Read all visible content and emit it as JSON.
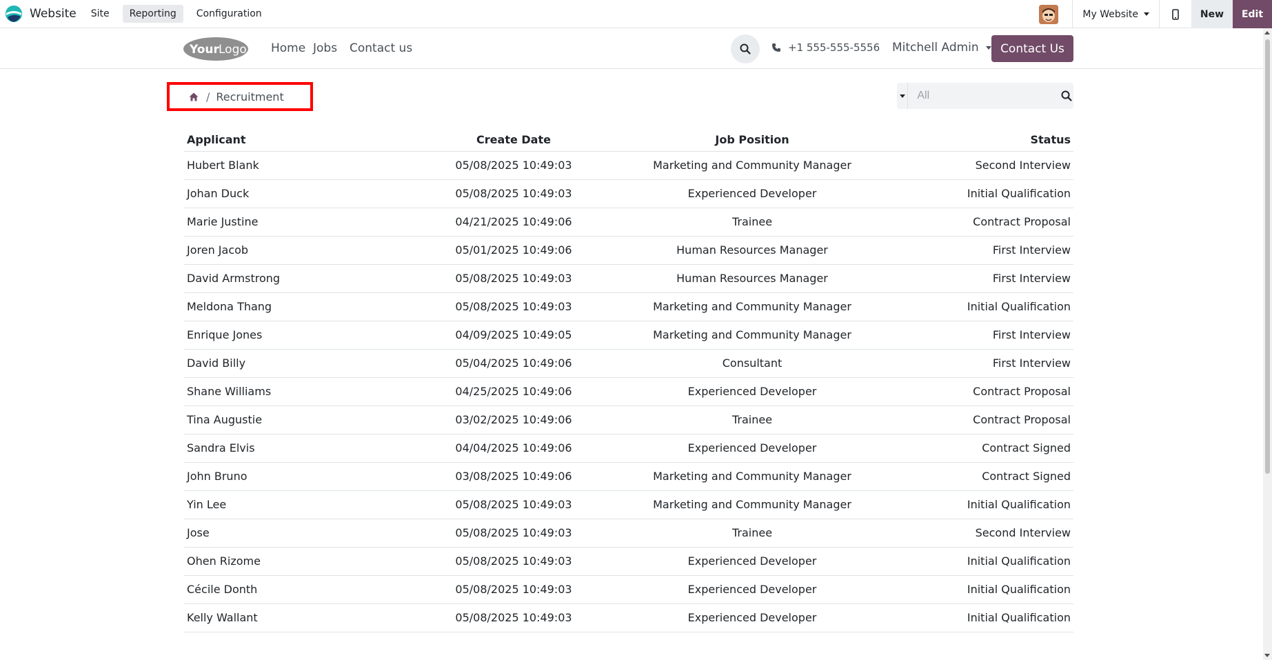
{
  "topbar": {
    "app_name": "Website",
    "menus": [
      "Site",
      "Reporting",
      "Configuration"
    ],
    "active_menu": "Reporting",
    "website_selector": "My Website",
    "new_label": "New",
    "edit_label": "Edit",
    "accent_color": "#714b67"
  },
  "header": {
    "logo_text": "YourLogo",
    "nav": [
      "Home",
      "Jobs",
      "Contact us"
    ],
    "phone": "+1 555-555-5556",
    "user": "Mitchell Admin",
    "contact_button": "Contact Us"
  },
  "breadcrumb": {
    "home_icon": "home-icon",
    "current": "Recruitment"
  },
  "search": {
    "placeholder": "All",
    "value": ""
  },
  "table": {
    "columns": [
      "Applicant",
      "Create Date",
      "Job Position",
      "Status"
    ],
    "rows": [
      [
        "Hubert Blank",
        "05/08/2025 10:49:03",
        "Marketing and Community Manager",
        "Second Interview"
      ],
      [
        "Johan Duck",
        "05/08/2025 10:49:03",
        "Experienced Developer",
        "Initial Qualification"
      ],
      [
        "Marie Justine",
        "04/21/2025 10:49:06",
        "Trainee",
        "Contract Proposal"
      ],
      [
        "Joren Jacob",
        "05/01/2025 10:49:06",
        "Human Resources Manager",
        "First Interview"
      ],
      [
        "David Armstrong",
        "05/08/2025 10:49:03",
        "Human Resources Manager",
        "First Interview"
      ],
      [
        "Meldona Thang",
        "05/08/2025 10:49:03",
        "Marketing and Community Manager",
        "Initial Qualification"
      ],
      [
        "Enrique Jones",
        "04/09/2025 10:49:05",
        "Marketing and Community Manager",
        "First Interview"
      ],
      [
        "David Billy",
        "05/04/2025 10:49:06",
        "Consultant",
        "First Interview"
      ],
      [
        "Shane Williams",
        "04/25/2025 10:49:06",
        "Experienced Developer",
        "Contract Proposal"
      ],
      [
        "Tina Augustie",
        "03/02/2025 10:49:06",
        "Trainee",
        "Contract Proposal"
      ],
      [
        "Sandra Elvis",
        "04/04/2025 10:49:06",
        "Experienced Developer",
        "Contract Signed"
      ],
      [
        "John Bruno",
        "03/08/2025 10:49:06",
        "Marketing and Community Manager",
        "Contract Signed"
      ],
      [
        "Yin Lee",
        "05/08/2025 10:49:03",
        "Marketing and Community Manager",
        "Initial Qualification"
      ],
      [
        "Jose",
        "05/08/2025 10:49:03",
        "Trainee",
        "Second Interview"
      ],
      [
        "Ohen Rizome",
        "05/08/2025 10:49:03",
        "Experienced Developer",
        "Initial Qualification"
      ],
      [
        "Cécile Donth",
        "05/08/2025 10:49:03",
        "Experienced Developer",
        "Initial Qualification"
      ],
      [
        "Kelly Wallant",
        "05/08/2025 10:49:03",
        "Experienced Developer",
        "Initial Qualification"
      ]
    ]
  }
}
